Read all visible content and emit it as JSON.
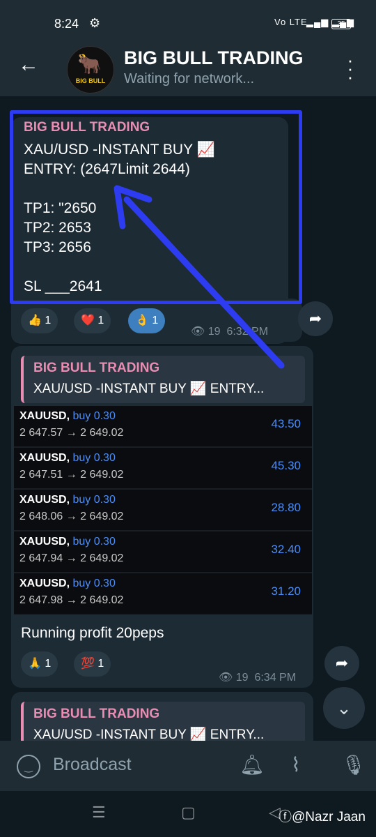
{
  "status": {
    "time": "8:24",
    "network": "Vo LTE",
    "battery": "35"
  },
  "header": {
    "title": "BIG BULL TRADING",
    "subtitle": "Waiting for network...",
    "avatar_text": "BIG BULL"
  },
  "message1": {
    "sender": "BIG BULL TRADING",
    "lines": [
      "XAU/USD -INSTANT BUY 📈",
      "ENTRY:  (2647Limit 2644)",
      "",
      "TP1: \"2650",
      "TP2:  2653",
      "TP3:  2656",
      "",
      "SL ___2641"
    ],
    "reactions": [
      {
        "emoji": "👍",
        "count": "1"
      },
      {
        "emoji": "❤️",
        "count": "1"
      },
      {
        "emoji": "👌",
        "count": "1"
      }
    ],
    "views": "19",
    "time": "6:32 PM"
  },
  "message2": {
    "quote_name": "BIG BULL TRADING",
    "quote_text": "XAU/USD -INSTANT BUY 📈      ENTRY...",
    "trades": [
      {
        "symbol": "XAUUSD,",
        "side": "buy 0.30",
        "prices": "2 647.57 → 2 649.02",
        "profit": "43.50"
      },
      {
        "symbol": "XAUUSD,",
        "side": "buy 0.30",
        "prices": "2 647.51 → 2 649.02",
        "profit": "45.30"
      },
      {
        "symbol": "XAUUSD,",
        "side": "buy 0.30",
        "prices": "2 648.06 → 2 649.02",
        "profit": "28.80"
      },
      {
        "symbol": "XAUUSD,",
        "side": "buy 0.30",
        "prices": "2 647.94 → 2 649.02",
        "profit": "32.40"
      },
      {
        "symbol": "XAUUSD,",
        "side": "buy 0.30",
        "prices": "2 647.98 → 2 649.02",
        "profit": "31.20"
      }
    ],
    "caption": "Running profit 20peps",
    "reactions": [
      {
        "emoji": "🙏",
        "count": "1"
      },
      {
        "emoji": "💯",
        "count": "1"
      }
    ],
    "views": "19",
    "time": "6:34 PM"
  },
  "message3": {
    "quote_name": "BIG BULL TRADING",
    "quote_text": "XAU/USD -INSTANT BUY 📈      ENTRY..."
  },
  "input": {
    "placeholder": "Broadcast"
  },
  "watermark": "@Nazr Jaan",
  "colors": {
    "highlight": "#2d3cf0",
    "accent_pink": "#e98db2",
    "trade_blue": "#4c8df6"
  }
}
